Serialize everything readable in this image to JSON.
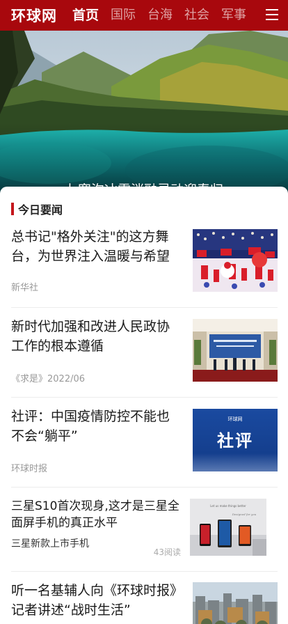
{
  "header": {
    "logo": "环球网",
    "tabs": [
      {
        "label": "首页",
        "active": true
      },
      {
        "label": "国际",
        "active": false
      },
      {
        "label": "台海",
        "active": false
      },
      {
        "label": "社会",
        "active": false
      },
      {
        "label": "军事",
        "active": false
      }
    ],
    "menu_icon": "hamburger-menu-icon",
    "background_color": "#a8080d"
  },
  "hero": {
    "caption": "九寨沟冰雪消融灵动迎春归",
    "slide_count": 5,
    "active_slide": 5
  },
  "section": {
    "title": "今日要闻",
    "accent_color": "#c4161c"
  },
  "articles": [
    {
      "title": "总书记\"格外关注\"的这方舞台，为世界注入温暖与希望",
      "source": "新华社"
    },
    {
      "title": "新时代加强和改进人民政协工作的根本遵循",
      "source": "《求是》2022/06"
    },
    {
      "title": "社评：中国疫情防控不能也不会“躺平”",
      "source": "环球时报",
      "thumb_text": "社评",
      "thumb_logo": "环球网"
    },
    {
      "title": "三星S10首次现身,这才是三星全面屏手机的真正水平",
      "subtitle": "三星新款上市手机",
      "reads": "43阅读"
    },
    {
      "title": "听一名基辅人向《环球时报》记者讲述“战时生活”"
    }
  ]
}
